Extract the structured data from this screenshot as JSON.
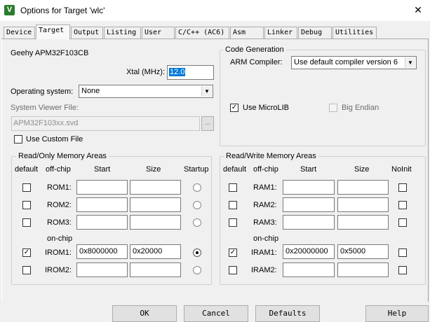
{
  "window": {
    "title": "Options for Target 'wlc'",
    "icon": "keil-uvision-icon",
    "close_glyph": "✕"
  },
  "tabs": [
    "Device",
    "Target",
    "Output",
    "Listing",
    "User",
    "C/C++ (AC6)",
    "Asm",
    "Linker",
    "Debug",
    "Utilities"
  ],
  "active_tab": "Target",
  "device": {
    "name": "Geehy APM32F103CB"
  },
  "xtal": {
    "label": "Xtal (MHz):",
    "value": "12.0"
  },
  "os": {
    "label": "Operating system:",
    "value": "None"
  },
  "svd": {
    "label": "System Viewer File:",
    "value": "APM32F103xx.svd",
    "browse": "...",
    "custom_label": "Use Custom File",
    "custom_checked": false
  },
  "codegen": {
    "title": "Code Generation",
    "compiler_label": "ARM Compiler:",
    "compiler_value": "Use default compiler version 6",
    "microlib_label": "Use MicroLIB",
    "microlib_checked": true,
    "bigendian_label": "Big Endian",
    "bigendian_checked": false
  },
  "rom": {
    "title": "Read/Only Memory Areas",
    "headers": {
      "default": "default",
      "offchip": "off-chip",
      "start": "Start",
      "size": "Size",
      "startup": "Startup"
    },
    "onchip_label": "on-chip",
    "rows": [
      {
        "name": "ROM1:",
        "default": false,
        "start": "",
        "size": "",
        "startup": false
      },
      {
        "name": "ROM2:",
        "default": false,
        "start": "",
        "size": "",
        "startup": false
      },
      {
        "name": "ROM3:",
        "default": false,
        "start": "",
        "size": "",
        "startup": false
      },
      {
        "name": "IROM1:",
        "default": true,
        "start": "0x8000000",
        "size": "0x20000",
        "startup": true
      },
      {
        "name": "IROM2:",
        "default": false,
        "start": "",
        "size": "",
        "startup": false
      }
    ]
  },
  "ram": {
    "title": "Read/Write Memory Areas",
    "headers": {
      "default": "default",
      "offchip": "off-chip",
      "start": "Start",
      "size": "Size",
      "noinit": "NoInit"
    },
    "onchip_label": "on-chip",
    "rows": [
      {
        "name": "RAM1:",
        "default": false,
        "start": "",
        "size": "",
        "noinit": false
      },
      {
        "name": "RAM2:",
        "default": false,
        "start": "",
        "size": "",
        "noinit": false
      },
      {
        "name": "RAM3:",
        "default": false,
        "start": "",
        "size": "",
        "noinit": false
      },
      {
        "name": "IRAM1:",
        "default": true,
        "start": "0x20000000",
        "size": "0x5000",
        "noinit": false
      },
      {
        "name": "IRAM2:",
        "default": false,
        "start": "",
        "size": "",
        "noinit": false
      }
    ]
  },
  "buttons": {
    "ok": "OK",
    "cancel": "Cancel",
    "defaults": "Defaults",
    "help": "Help"
  },
  "check_glyph": "✓"
}
